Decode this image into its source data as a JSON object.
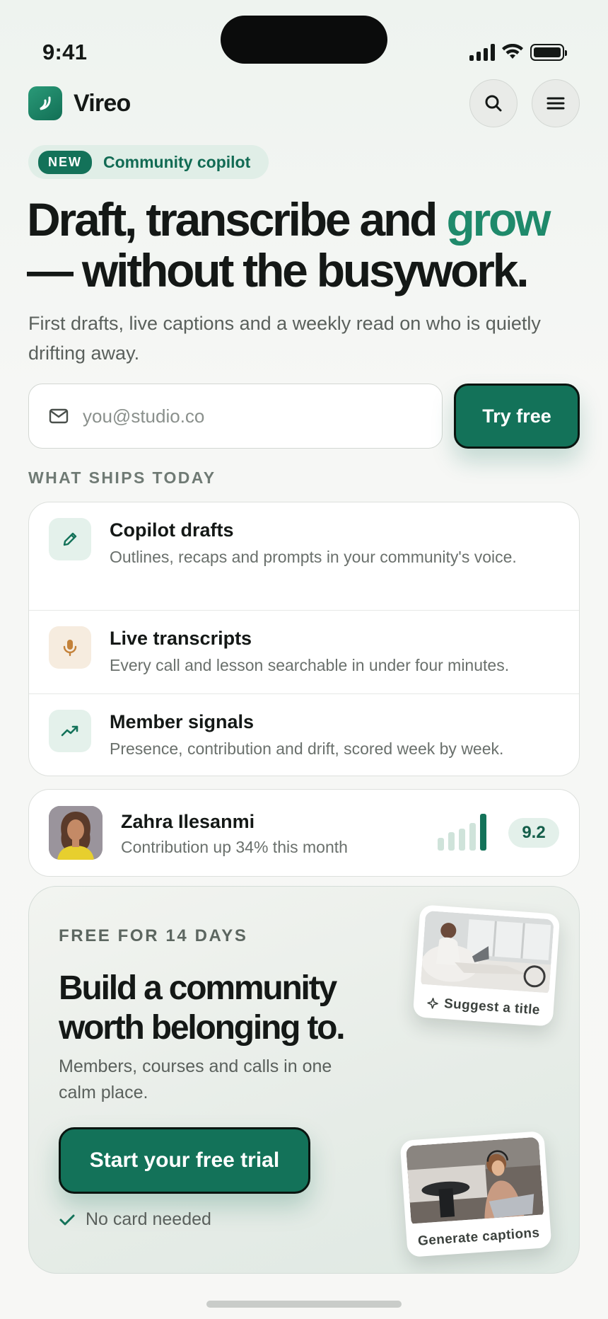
{
  "status": {
    "time": "9:41"
  },
  "app": {
    "name": "Vireo"
  },
  "header": {
    "search_icon": "search-icon",
    "menu_icon": "menu-icon"
  },
  "badge": {
    "tag": "NEW",
    "text": "Community copilot"
  },
  "hero": {
    "title_lead": "Draft, transcribe and ",
    "title_accent": "grow",
    "title_tail": "— without the busywork.",
    "subtitle": "First drafts, live captions and a weekly read on who is quietly drifting away.",
    "email_placeholder": "you@studio.co",
    "cta": "Try free"
  },
  "features": {
    "section_label": "WHAT SHIPS TODAY",
    "items": [
      {
        "title": "Copilot drafts",
        "desc": "Outlines, recaps and prompts in your community's voice.",
        "icon": "pencil-icon"
      },
      {
        "title": "Live transcripts",
        "desc": "Every call and lesson searchable in under four minutes.",
        "icon": "microphone-icon"
      },
      {
        "title": "Member signals",
        "desc": "Presence, contribution and drift, scored week by week.",
        "icon": "trend-up-icon"
      }
    ]
  },
  "member": {
    "name": "Zahra Ilesanmi",
    "subtitle": "Contribution up 34% this month",
    "score": "9.2",
    "activity_levels": [
      0.35,
      0.5,
      0.6,
      0.75,
      1.0
    ]
  },
  "promo": {
    "label": "FREE FOR 14 DAYS",
    "title": "Build a community worth belonging to.",
    "subtitle": "Members, courses and calls in one calm place.",
    "cta": "Start your free trial",
    "note": "No card needed",
    "card_top_caption": "Suggest a title",
    "card_bottom_caption": "Generate captions"
  },
  "colors": {
    "accent": "#137259",
    "accent_text": "#1f8a6b",
    "ink": "#141816",
    "muted": "#6a706c"
  }
}
